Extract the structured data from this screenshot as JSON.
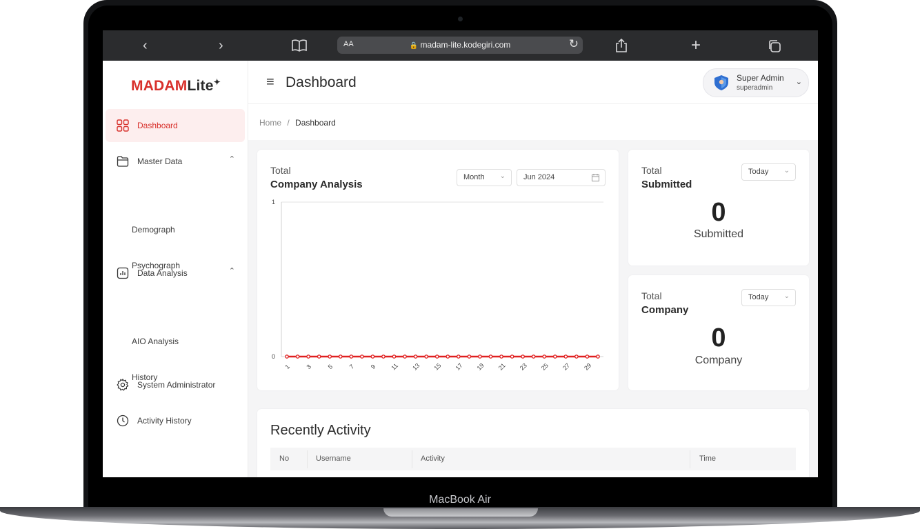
{
  "device": {
    "brand_label": "MacBook Air"
  },
  "browser": {
    "back_icon": "chevron-left-icon",
    "forward_icon": "chevron-right-icon",
    "reader_icon": "book-icon",
    "text_size_label": "AA",
    "url": "madam-lite.kodegiri.com",
    "lock_icon": "lock-icon",
    "reload_icon": "reload-icon",
    "share_icon": "share-icon",
    "new_tab_icon": "plus-icon",
    "tabs_icon": "tabs-icon"
  },
  "app": {
    "logo_part1": "MADAM",
    "logo_part2": "Lite",
    "logo_mark": "✦",
    "page_title": "Dashboard",
    "user": {
      "name": "Super Admin",
      "role": "superadmin"
    }
  },
  "sidebar": {
    "items": [
      {
        "label": "Dashboard",
        "icon": "grid-icon",
        "active": true
      },
      {
        "label": "Master Data",
        "icon": "folder-icon",
        "expanded": true,
        "children": [
          "Demograph",
          "Psychograph"
        ]
      },
      {
        "label": "Data Analysis",
        "icon": "chart-icon",
        "expanded": true,
        "children": [
          "AIO Analysis",
          "History"
        ]
      },
      {
        "label": "System Administrator",
        "icon": "gear-icon"
      },
      {
        "label": "Activity History",
        "icon": "clock-icon"
      }
    ]
  },
  "breadcrumb": {
    "home": "Home",
    "separator": "/",
    "current": "Dashboard"
  },
  "company_analysis": {
    "total_label": "Total",
    "title": "Company Analysis",
    "period_select": "Month",
    "month_input": "Jun 2024",
    "calendar_icon": "calendar-icon"
  },
  "submitted_card": {
    "total_label": "Total",
    "title": "Submitted",
    "filter": "Today",
    "value": "0",
    "caption": "Submitted"
  },
  "company_card": {
    "total_label": "Total",
    "title": "Company",
    "filter": "Today",
    "value": "0",
    "caption": "Company"
  },
  "recent_activity": {
    "title": "Recently Activity",
    "columns": [
      "No",
      "Username",
      "Activity",
      "Time"
    ]
  },
  "colors": {
    "accent": "#d8302b",
    "line": "#e02020"
  },
  "chart_data": {
    "type": "line",
    "x": [
      1,
      2,
      3,
      4,
      5,
      6,
      7,
      8,
      9,
      10,
      11,
      12,
      13,
      14,
      15,
      16,
      17,
      18,
      19,
      20,
      21,
      22,
      23,
      24,
      25,
      26,
      27,
      28,
      29,
      30
    ],
    "x_tick_labels": [
      "1",
      "3",
      "5",
      "7",
      "9",
      "11",
      "13",
      "15",
      "17",
      "19",
      "21",
      "23",
      "25",
      "27",
      "29"
    ],
    "series": [
      {
        "values": [
          0,
          0,
          0,
          0,
          0,
          0,
          0,
          0,
          0,
          0,
          0,
          0,
          0,
          0,
          0,
          0,
          0,
          0,
          0,
          0,
          0,
          0,
          0,
          0,
          0,
          0,
          0,
          0,
          0,
          0
        ]
      }
    ],
    "y_tick_labels": [
      "0",
      "1"
    ],
    "ylim": [
      0,
      1
    ],
    "grid": false
  }
}
